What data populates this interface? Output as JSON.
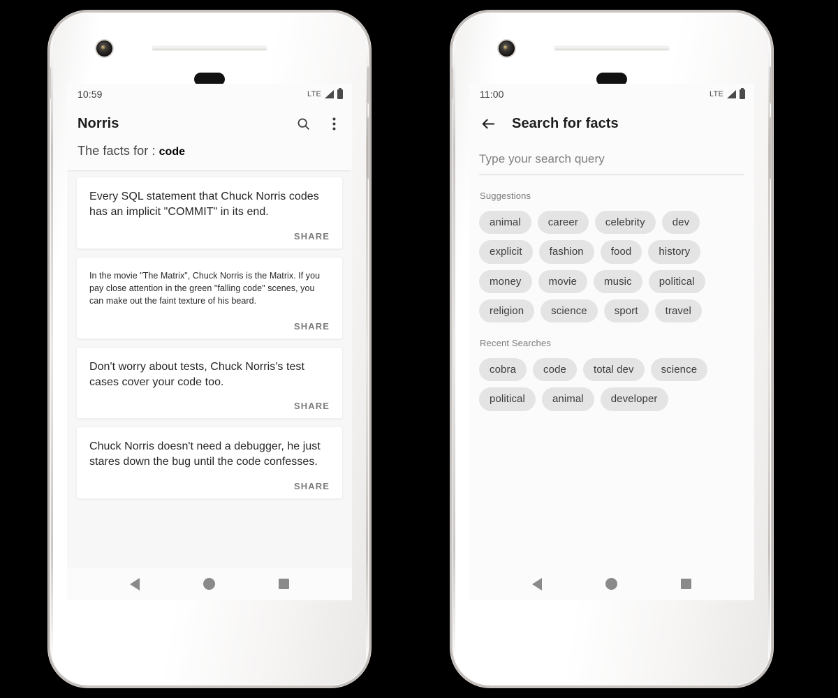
{
  "phones": {
    "left": {
      "status_bar": {
        "time": "10:59",
        "network": "LTE"
      },
      "app_bar": {
        "title": "Norris",
        "search_icon": "search-icon",
        "overflow_icon": "more-vertical-icon"
      },
      "subtitle": {
        "prefix": "The facts for : ",
        "query": "code"
      },
      "share_label": "SHARE",
      "facts": [
        {
          "text": "Every SQL statement that Chuck Norris codes has an implicit \"COMMIT\" in its end.",
          "size": "normal"
        },
        {
          "text": "In the movie \"The Matrix\", Chuck Norris is the Matrix. If you pay close attention in the green \"falling code\" scenes, you can make out the faint texture of his beard.",
          "size": "small"
        },
        {
          "text": "Don't worry about tests, Chuck Norris's test cases cover your code too.",
          "size": "normal"
        },
        {
          "text": "Chuck Norris doesn't need a debugger, he just stares down the bug until the code confesses.",
          "size": "normal"
        }
      ],
      "nav": {
        "back": "back-triangle-icon",
        "home": "home-circle-icon",
        "recents": "recents-square-icon"
      }
    },
    "right": {
      "status_bar": {
        "time": "11:00",
        "network": "LTE"
      },
      "app_bar": {
        "back_icon": "arrow-left-icon",
        "title": "Search for facts"
      },
      "search_input": {
        "value": "",
        "placeholder": "Type your search query"
      },
      "suggestions": {
        "label": "Suggestions",
        "chips": [
          "animal",
          "career",
          "celebrity",
          "dev",
          "explicit",
          "fashion",
          "food",
          "history",
          "money",
          "movie",
          "music",
          "political",
          "religion",
          "science",
          "sport",
          "travel"
        ]
      },
      "recent_searches": {
        "label": "Recent Searches",
        "chips": [
          "cobra",
          "code",
          "total dev",
          "science",
          "political",
          "animal",
          "developer"
        ]
      },
      "nav": {
        "back": "back-triangle-icon",
        "home": "home-circle-icon",
        "recents": "recents-square-icon"
      }
    }
  },
  "colors": {
    "screen_bg": "#f7f7f7",
    "surface": "#fbfbfb",
    "card": "#ffffff",
    "chip_bg": "#e4e4e4",
    "text_primary": "#1c1c1c",
    "text_secondary": "#7a7a7a",
    "nav_icon": "#8a8a8a",
    "canvas": "#000000"
  }
}
